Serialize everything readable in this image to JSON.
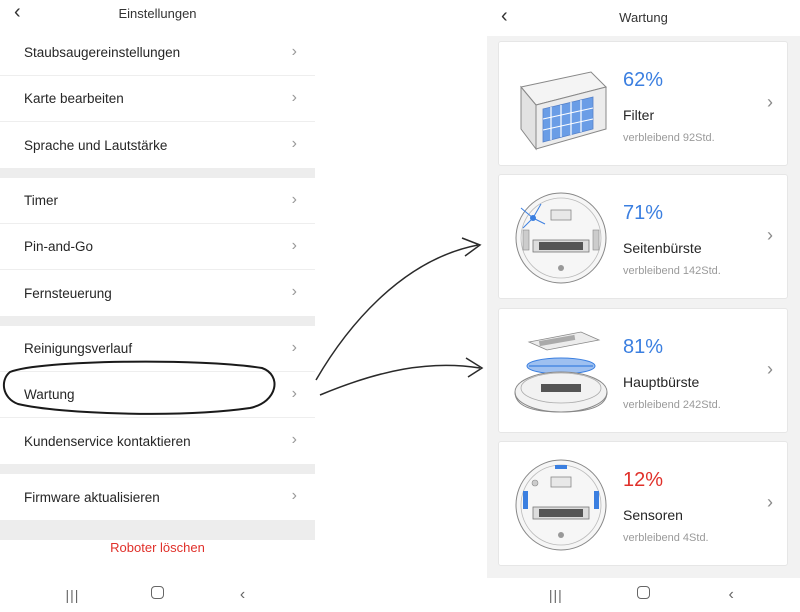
{
  "settings": {
    "title": "Einstellungen",
    "groups": [
      [
        "Staubsaugereinstellungen",
        "Karte bearbeiten",
        "Sprache und Lautstärke"
      ],
      [
        "Timer",
        "Pin-and-Go",
        "Fernsteuerung"
      ],
      [
        "Reinigungsverlauf",
        "Wartung",
        "Kundenservice kontaktieren"
      ],
      [
        "Firmware aktualisieren"
      ]
    ],
    "delete_label": "Roboter löschen"
  },
  "maintenance": {
    "title": "Wartung",
    "items": [
      {
        "percent": "62%",
        "name": "Filter",
        "remaining": "verbleibend 92Std.",
        "color": "#3b7fe0",
        "icon": "filter-icon"
      },
      {
        "percent": "71%",
        "name": "Seitenbürste",
        "remaining": "verbleibend 142Std.",
        "color": "#3b7fe0",
        "icon": "side-brush-icon"
      },
      {
        "percent": "81%",
        "name": "Hauptbürste",
        "remaining": "verbleibend 242Std.",
        "color": "#3b7fe0",
        "icon": "main-brush-icon"
      },
      {
        "percent": "12%",
        "name": "Sensoren",
        "remaining": "verbleibend 4Std.",
        "color": "#e0302a",
        "icon": "sensor-icon"
      }
    ]
  },
  "icons": {
    "back": "chevron-left-icon",
    "row_chevron": "chevron-right-icon",
    "nav": [
      "recent-apps-icon",
      "home-icon",
      "back-icon"
    ]
  },
  "colors": {
    "accent_blue": "#3b7fe0",
    "danger_red": "#e0302a",
    "separator": "#ededed"
  }
}
